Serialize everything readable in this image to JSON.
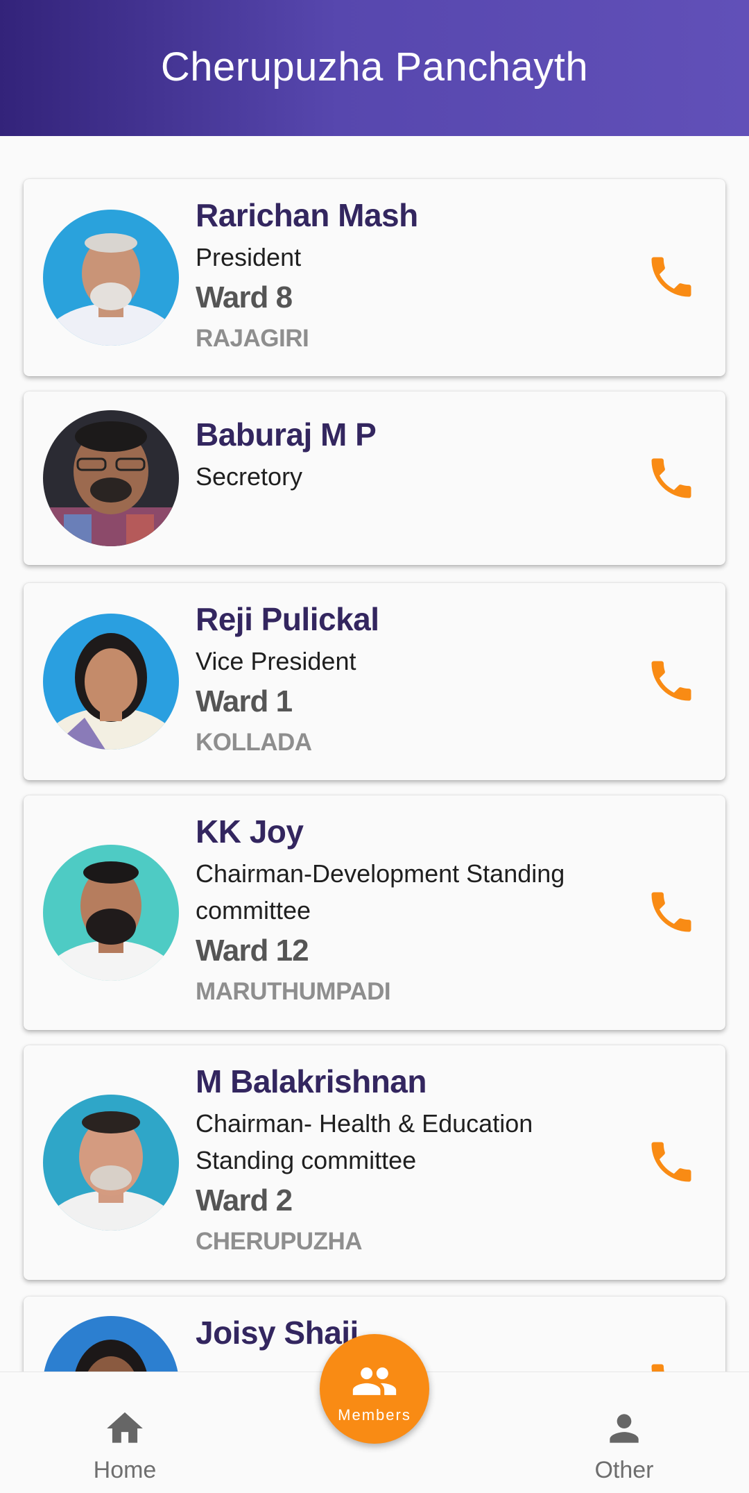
{
  "header": {
    "title": "Cherupuzha Panchayth"
  },
  "members": [
    {
      "name": "Rarichan Mash",
      "role": "President",
      "ward": "Ward 8",
      "place": "RAJAGIRI"
    },
    {
      "name": "Baburaj M P",
      "role": "Secretory",
      "ward": "",
      "place": ""
    },
    {
      "name": "Reji Pulickal",
      "role": "Vice President",
      "ward": "Ward 1",
      "place": "KOLLADA"
    },
    {
      "name": "KK Joy",
      "role": "Chairman-Development Standing committee",
      "ward": "Ward 12",
      "place": "MARUTHUMPADI"
    },
    {
      "name": "M Balakrishnan",
      "role": "Chairman- Health & Education Standing committee",
      "ward": "Ward 2",
      "place": "CHERUPUZHA"
    },
    {
      "name": "Joisy Shaji",
      "role": "",
      "ward": "",
      "place": ""
    }
  ],
  "nav": {
    "home_label": "Home",
    "members_label": "Members",
    "other_label": "Other"
  },
  "icons": {
    "call": "phone-icon",
    "home": "home-icon",
    "members": "people-icon",
    "other": "person-icon"
  },
  "colors": {
    "header_start": "#33237a",
    "header_end": "#6150b8",
    "accent": "#f98b14",
    "name_text": "#33265f"
  }
}
